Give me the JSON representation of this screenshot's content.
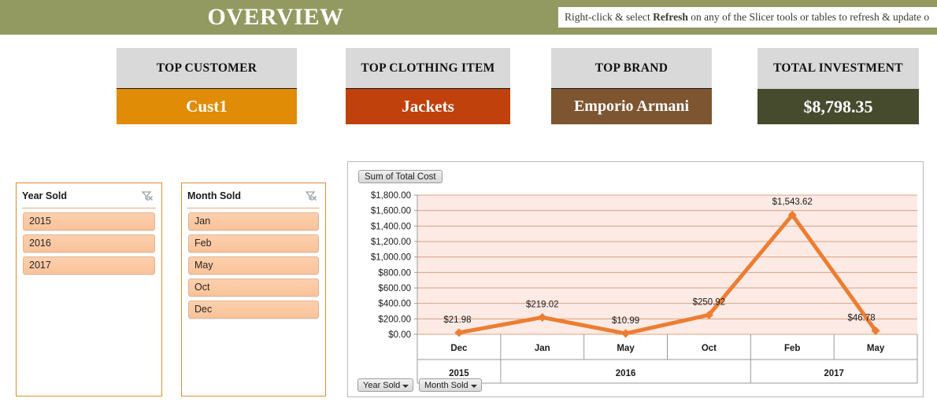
{
  "banner": {
    "title": "OVERVIEW",
    "note_prefix": "Right-click & select ",
    "note_bold": "Refresh",
    "note_suffix": " on any of the Slicer tools or tables to refresh  & update o"
  },
  "kpis": [
    {
      "name": "top-customer",
      "label": "TOP CUSTOMER",
      "value": "Cust1",
      "color": "#e08c06"
    },
    {
      "name": "top-clothing-item",
      "label": "TOP CLOTHING ITEM",
      "value": "Jackets",
      "color": "#c0410c"
    },
    {
      "name": "top-brand",
      "label": "TOP BRAND",
      "value": "Emporio Armani",
      "color": "#7d5530"
    },
    {
      "name": "total-investment",
      "label": "TOTAL INVESTMENT",
      "value": "$8,798.35",
      "color": "#474b2e"
    }
  ],
  "slicers": [
    {
      "name": "year-sold",
      "title": "Year Sold",
      "clear_icon": "clear-filter-icon",
      "items": [
        "2015",
        "2016",
        "2017"
      ]
    },
    {
      "name": "month-sold",
      "title": "Month Sold",
      "clear_icon": "clear-filter-icon",
      "items": [
        "Jan",
        "Feb",
        "May",
        "Oct",
        "Dec"
      ]
    }
  ],
  "chart_panel": {
    "legend_button": "Sum of Total Cost",
    "field_buttons": [
      "Year Sold",
      "Month Sold"
    ]
  },
  "chart_data": {
    "type": "line",
    "title": "Sum of Total Cost",
    "series": [
      {
        "name": "Sum of Total Cost",
        "values": [
          21.98,
          219.02,
          10.99,
          250.92,
          1543.62,
          46.78
        ],
        "labels": [
          "$21.98",
          "$219.02",
          "$10.99",
          "$250.92",
          "$1,543.62",
          "$46.78"
        ],
        "color": "#ED7D31"
      }
    ],
    "categories": [
      "Dec",
      "Jan",
      "May",
      "Oct",
      "Feb",
      "May"
    ],
    "group_labels": [
      "2015",
      "2016",
      "2017"
    ],
    "group_spans": [
      1,
      3,
      2
    ],
    "ylim": [
      0,
      1800
    ],
    "ytick_step": 200,
    "yticks": [
      "$1,800.00",
      "$1,600.00",
      "$1,400.00",
      "$1,200.00",
      "$1,000.00",
      "$800.00",
      "$600.00",
      "$400.00",
      "$200.00",
      "$0.00"
    ],
    "xlabel": "",
    "ylabel": "",
    "grid": true,
    "legend_position": "top-left",
    "plot_bg": "#FDEAE4",
    "grid_color": "#D9A183"
  }
}
